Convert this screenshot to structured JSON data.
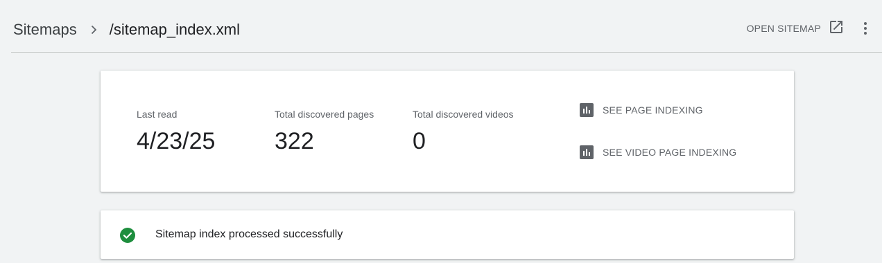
{
  "breadcrumb": {
    "parent": "Sitemaps",
    "separator_icon": "chevron-right-icon",
    "current": "/sitemap_index.xml"
  },
  "header": {
    "open_sitemap_label": "OPEN SITEMAP",
    "open_icon": "open-in-new-icon",
    "more_icon": "more-vert-icon"
  },
  "stats": [
    {
      "label": "Last read",
      "value": "4/23/25"
    },
    {
      "label": "Total discovered pages",
      "value": "322"
    },
    {
      "label": "Total discovered videos",
      "value": "0"
    }
  ],
  "links": [
    {
      "label": "SEE PAGE INDEXING",
      "icon": "bar-chart-icon"
    },
    {
      "label": "SEE VIDEO PAGE INDEXING",
      "icon": "bar-chart-icon"
    }
  ],
  "status": {
    "text": "Sitemap index processed successfully",
    "icon": "check-circle-icon"
  },
  "colors": {
    "background": "#f1f3f4",
    "card": "#ffffff",
    "success": "#1e8e3e",
    "icon_gray": "#5f6368"
  }
}
